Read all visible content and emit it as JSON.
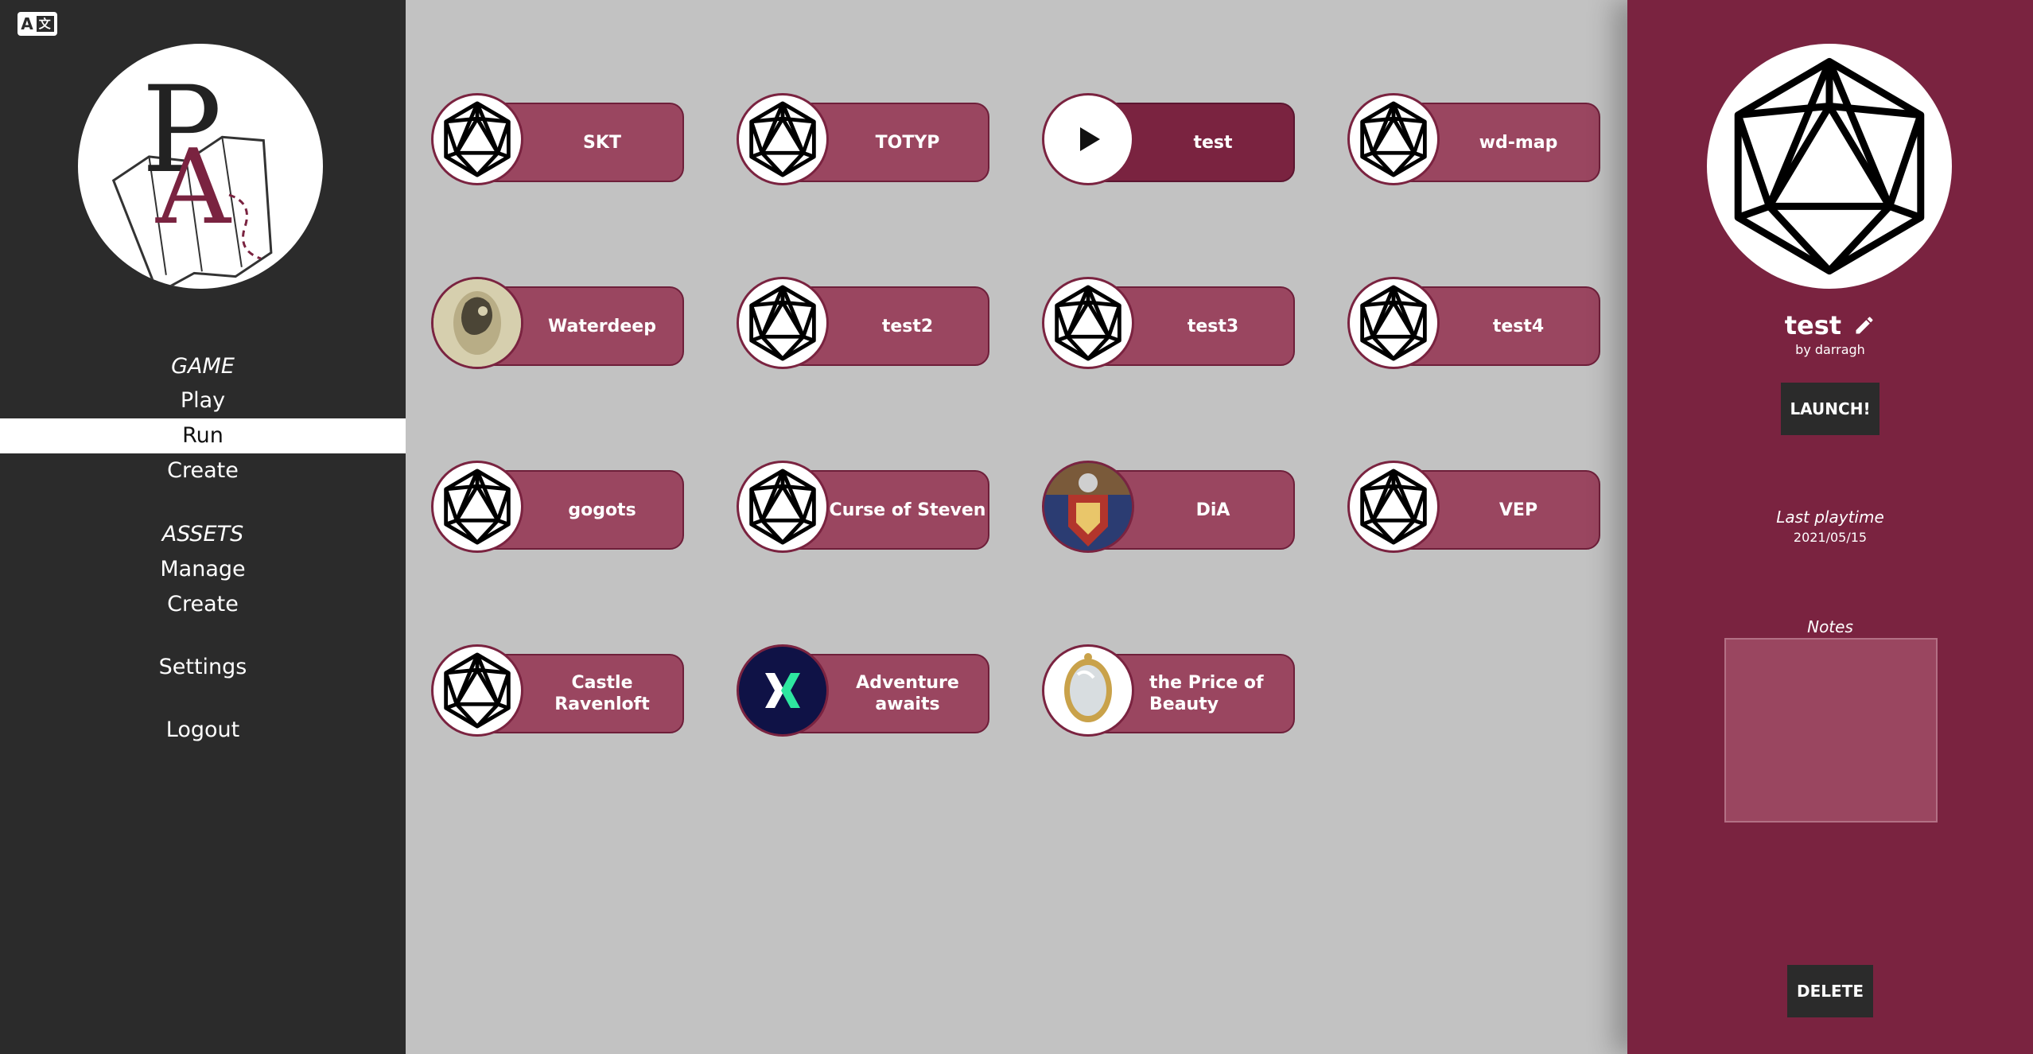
{
  "language_toggle": {
    "label": "A",
    "alt_glyph": "文"
  },
  "logo": {
    "letters": "PA",
    "icon": "map-logo"
  },
  "nav": {
    "game_heading": "GAME",
    "play": "Play",
    "run": "Run",
    "create_game": "Create",
    "assets_heading": "ASSETS",
    "manage": "Manage",
    "create_asset": "Create",
    "settings": "Settings",
    "logout": "Logout"
  },
  "games": [
    {
      "title": "SKT",
      "thumb": "d20-icon"
    },
    {
      "title": "TOTYP",
      "thumb": "d20-icon"
    },
    {
      "title": "test",
      "thumb": "play-icon",
      "selected": true
    },
    {
      "title": "wd-map",
      "thumb": "d20-icon"
    },
    {
      "title": "Waterdeep",
      "thumb": "waterdeep-image"
    },
    {
      "title": "test2",
      "thumb": "d20-icon"
    },
    {
      "title": "test3",
      "thumb": "d20-icon"
    },
    {
      "title": "test4",
      "thumb": "d20-icon"
    },
    {
      "title": "gogots",
      "thumb": "d20-icon"
    },
    {
      "title": "Curse of Steven",
      "thumb": "d20-icon"
    },
    {
      "title": "DiA",
      "thumb": "dia-image"
    },
    {
      "title": "VEP",
      "thumb": "d20-icon"
    },
    {
      "title": "Castle Ravenloft",
      "thumb": "d20-icon"
    },
    {
      "title": "Adventure awaits",
      "thumb": "adventure-logo"
    },
    {
      "title": "the Price of Beauty",
      "thumb": "mirror-image"
    }
  ],
  "detail": {
    "title": "test",
    "author": "by darragh",
    "launch_label": "LAUNCH!",
    "last_playtime_label": "Last playtime",
    "last_playtime_value": "2021/05/15",
    "notes_label": "Notes",
    "notes_value": "",
    "delete_label": "DELETE"
  },
  "colors": {
    "sidebar": "#2b2b2b",
    "accent": "#7a2340",
    "card": "#9a4660",
    "background": "#c2c2c2"
  }
}
